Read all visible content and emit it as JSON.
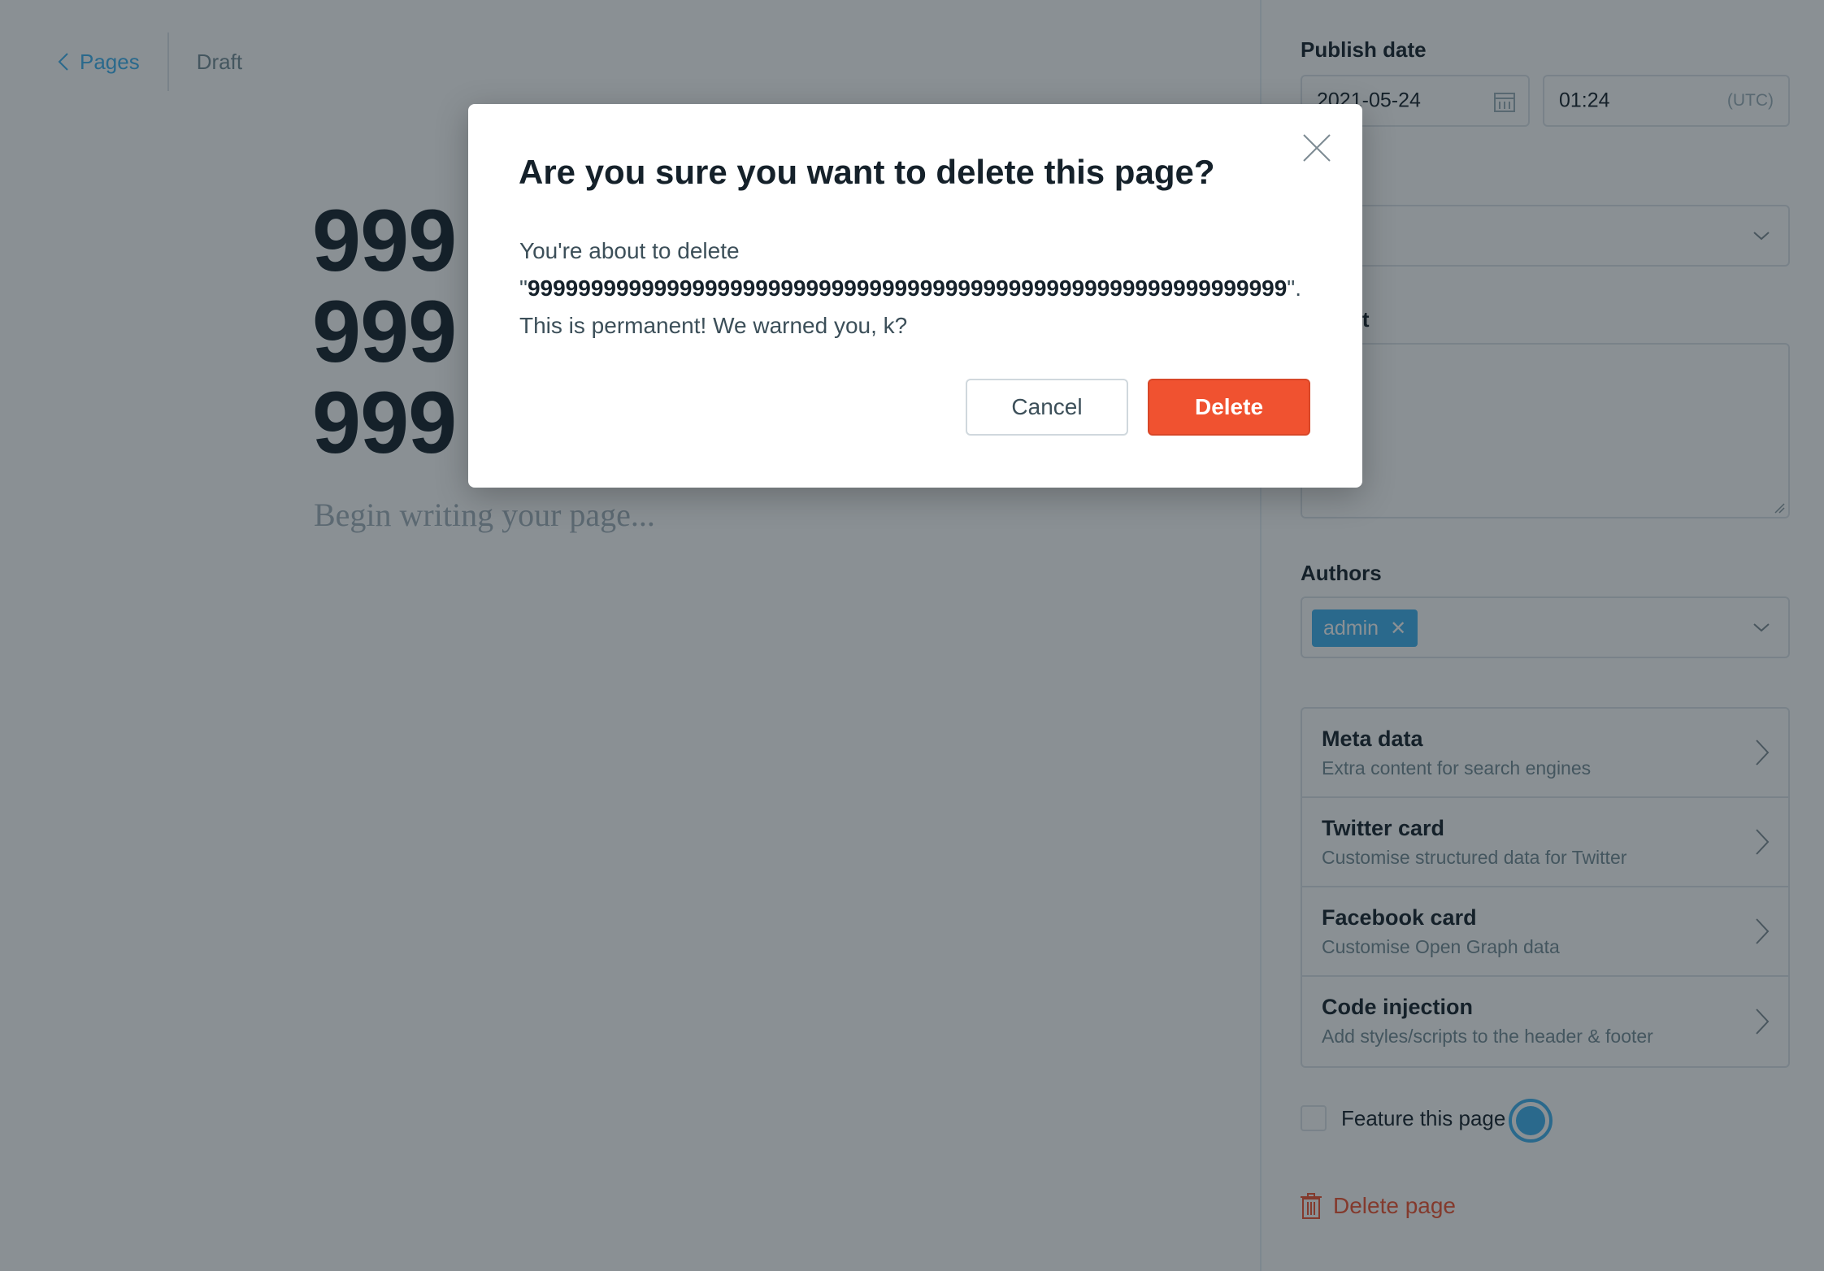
{
  "breadcrumb": {
    "back_label": "Pages",
    "status": "Draft"
  },
  "editor": {
    "title_lines": [
      "999",
      "999",
      "999"
    ],
    "placeholder": "Begin writing your page..."
  },
  "sidebar": {
    "publish_date_label": "Publish date",
    "date_value": "2021-05-24",
    "time_value": "01:24",
    "timezone": "(UTC)",
    "excerpt_partial_label": "pt",
    "authors_label": "Authors",
    "author_tag": "admin",
    "settings": [
      {
        "title": "Meta data",
        "desc": "Extra content for search engines"
      },
      {
        "title": "Twitter card",
        "desc": "Customise structured data for Twitter"
      },
      {
        "title": "Facebook card",
        "desc": "Customise Open Graph data"
      },
      {
        "title": "Code injection",
        "desc": "Add styles/scripts to the header & footer"
      }
    ],
    "feature_label": "Feature this page",
    "delete_label": "Delete page"
  },
  "modal": {
    "title": "Are you sure you want to delete this page?",
    "body_intro": "You're about to delete",
    "page_name": "999999999999999999999999999999999999999999999999999999999999",
    "body_warning": "This is permanent! We warned you, k?",
    "cancel_label": "Cancel",
    "delete_label": "Delete"
  },
  "colors": {
    "accent": "#3eb0ef",
    "danger": "#f05230",
    "text": "#15212a",
    "muted": "#738a94"
  }
}
